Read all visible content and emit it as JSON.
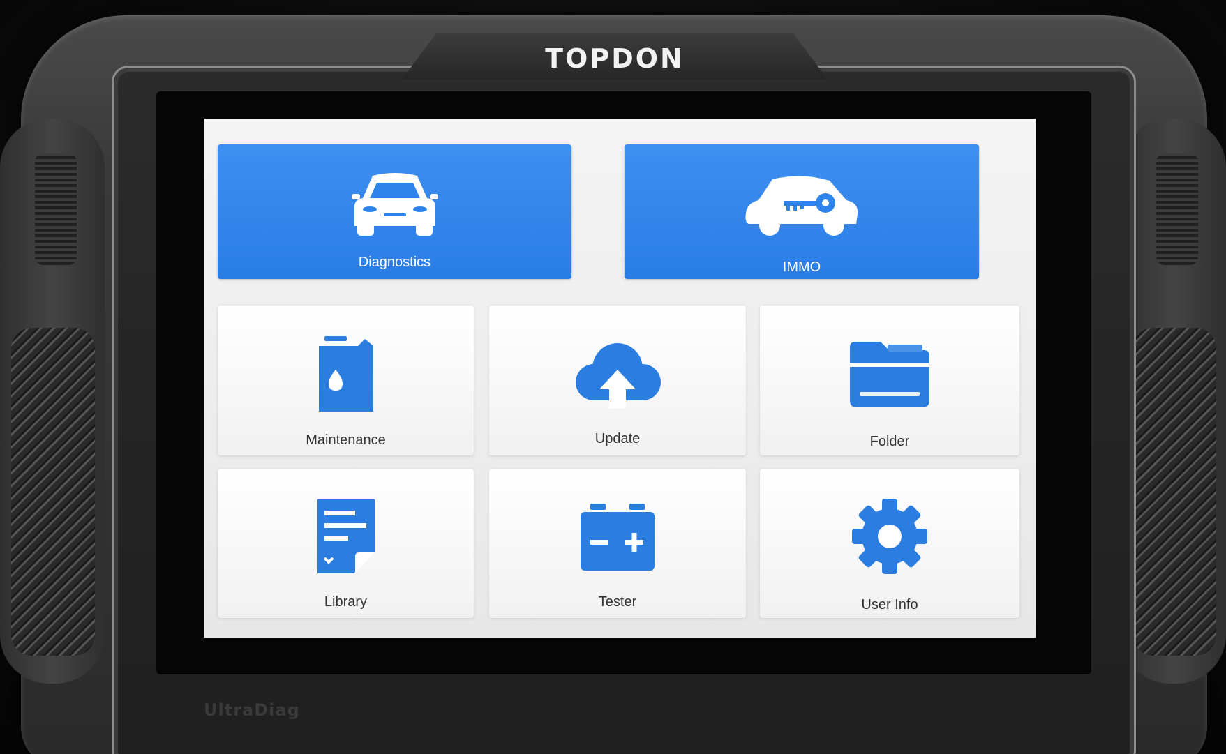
{
  "device": {
    "brand": "TOPDON",
    "model_mark": "UltraDiag"
  },
  "home": {
    "primary_tiles": [
      {
        "label": "Diagnostics",
        "icon": "car-icon"
      },
      {
        "label": "IMMO",
        "icon": "car-key-icon"
      }
    ],
    "grid_tiles": [
      {
        "label": "Maintenance",
        "icon": "oil-can-icon"
      },
      {
        "label": "Update",
        "icon": "cloud-upload-icon"
      },
      {
        "label": "Folder",
        "icon": "folder-icon"
      },
      {
        "label": "Library",
        "icon": "document-icon"
      },
      {
        "label": "Tester",
        "icon": "battery-icon"
      },
      {
        "label": "User Info",
        "icon": "gear-icon"
      }
    ]
  },
  "colors": {
    "primary_tile": "#2f84ec",
    "icon_blue": "#2b7de0",
    "tile_background": "#f8f8f8"
  }
}
